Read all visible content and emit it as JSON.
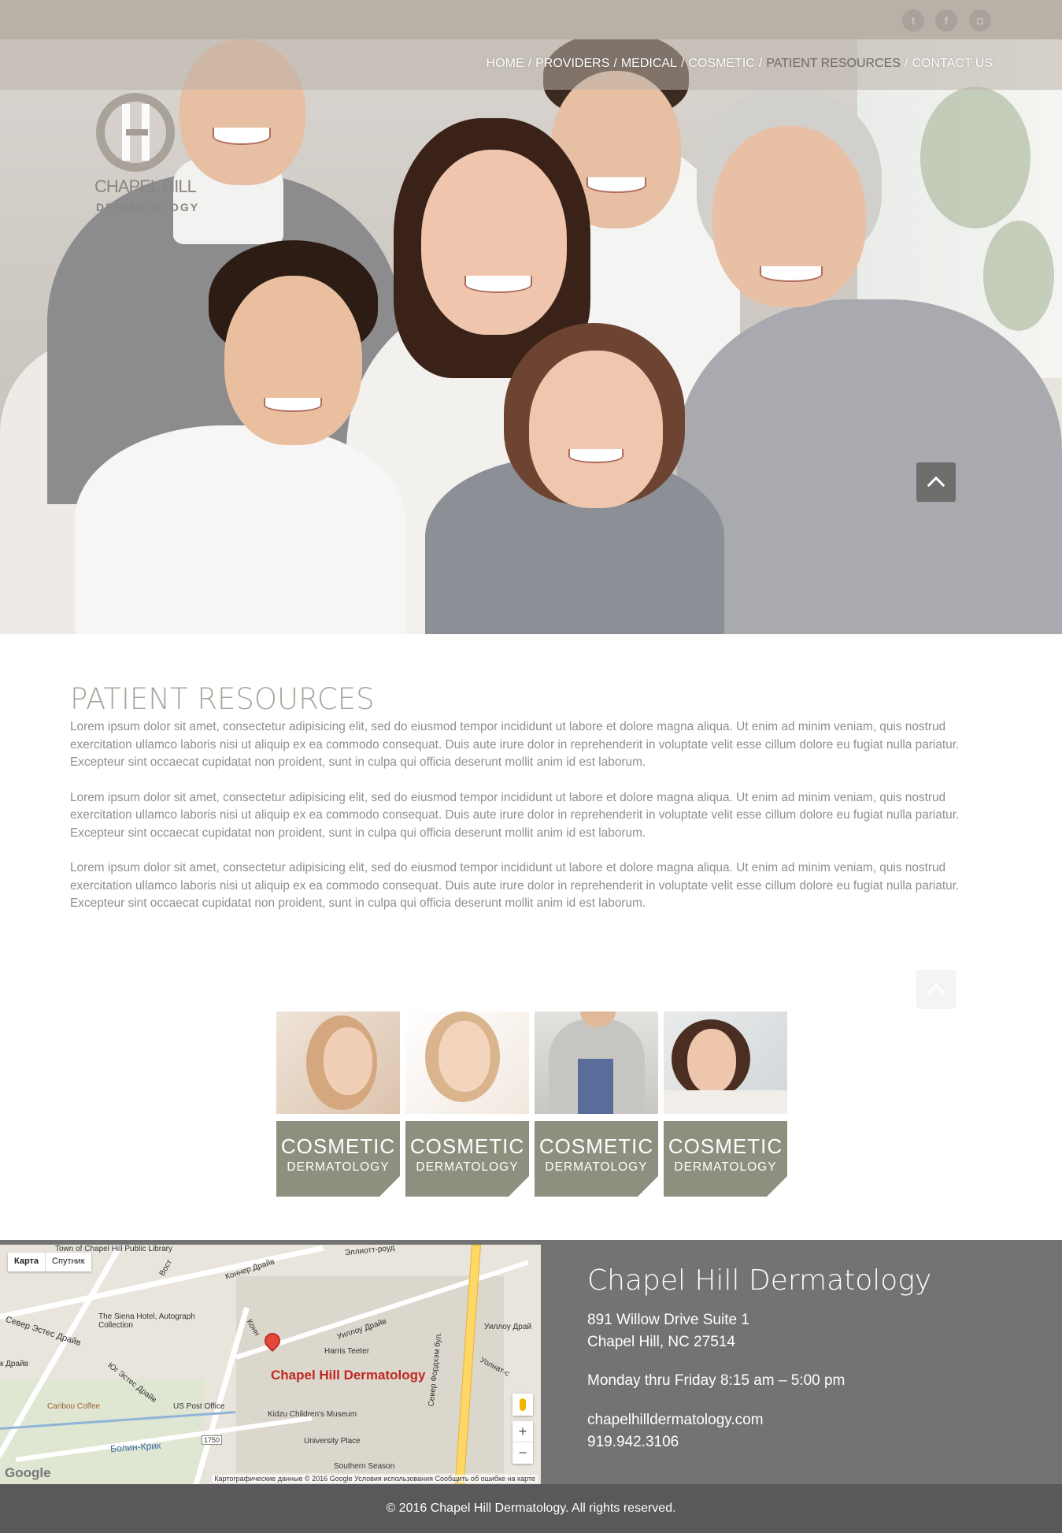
{
  "nav": {
    "items": [
      {
        "label": "HOME"
      },
      {
        "label": "PROVIDERS"
      },
      {
        "label": "MEDICAL"
      },
      {
        "label": "COSMETIC"
      },
      {
        "label": "PATIENT RESOURCES"
      },
      {
        "label": "CONTACT US"
      }
    ],
    "separator": "/"
  },
  "social": {
    "twitter": "t",
    "facebook": "f",
    "instagram": "◘"
  },
  "logo": {
    "line1": "CHAPEL HILL",
    "line2": "DERMATOLOGY"
  },
  "main": {
    "title": "PATIENT RESOURCES",
    "paragraphs": [
      "Lorem ipsum dolor sit amet, consectetur adipisicing elit, sed do eiusmod tempor incididunt ut labore et dolore magna aliqua. Ut enim ad minim veniam, quis nostrud exercitation ullamco laboris nisi ut aliquip ex ea commodo consequat. Duis aute irure dolor in reprehenderit in voluptate velit esse cillum dolore eu fugiat nulla pariatur. Excepteur sint occaecat cupidatat non proident, sunt in culpa qui officia deserunt mollit anim id est laborum.",
      "Lorem ipsum dolor sit amet, consectetur adipisicing elit, sed do eiusmod tempor incididunt ut labore et dolore magna aliqua. Ut enim ad minim veniam, quis nostrud exercitation ullamco laboris nisi ut aliquip ex ea commodo consequat. Duis aute irure dolor in reprehenderit in voluptate velit esse cillum dolore eu fugiat nulla pariatur. Excepteur sint occaecat cupidatat non proident, sunt in culpa qui officia deserunt mollit anim id est laborum.",
      "Lorem ipsum dolor sit amet, consectetur adipisicing elit, sed do eiusmod tempor incididunt ut labore et dolore magna aliqua. Ut enim ad minim veniam, quis nostrud exercitation ullamco laboris nisi ut aliquip ex ea commodo consequat. Duis aute irure dolor in reprehenderit in voluptate velit esse cillum dolore eu fugiat nulla pariatur. Excepteur sint occaecat cupidatat non proident, sunt in culpa qui officia deserunt mollit anim id est laborum."
    ]
  },
  "tiles": [
    {
      "title": "COSMETIC",
      "subtitle": "DERMATOLOGY"
    },
    {
      "title": "COSMETIC",
      "subtitle": "DERMATOLOGY"
    },
    {
      "title": "COSMETIC",
      "subtitle": "DERMATOLOGY"
    },
    {
      "title": "COSMETIC",
      "subtitle": "DERMATOLOGY"
    }
  ],
  "map": {
    "type_map": "Карта",
    "type_satellite": "Спутник",
    "marker_label": "Chapel Hill Dermatology",
    "zoom_in": "+",
    "zoom_out": "−",
    "attribution": "Картографические данные © 2016 Google   Условия использования   Сообщить об ошибке на карте",
    "google": "Google",
    "labels": {
      "library": "Town of Chapel Hill Public Library",
      "elliott": "Эллиотт-роуд",
      "konner": "Коннер Драйв",
      "siena": "The Siena Hotel, Autograph Collection",
      "willow": "Уиллоу Драйв",
      "willow2": "Уиллоу Драй",
      "harris": "Harris Teeter",
      "estes": "Север Эстес Драйв",
      "drive": "к Драйв",
      "caribou": "Caribou Coffee",
      "south_estes": "Юг Эстес Драйв",
      "post": "US Post Office",
      "kidzu": "Kidzu Children's Museum",
      "fordham": "Север Фордхэм бул.",
      "university": "University Place",
      "bolin": "Болин-Крик",
      "route": "1750",
      "southern": "Southern Season",
      "yolnat": "Уолнат-с",
      "konner_short": "Конн",
      "vost": "Вост"
    }
  },
  "contact": {
    "name": "Chapel Hill Dermatology",
    "address1": "891 Willow Drive Suite 1",
    "address2": "Chapel Hill, NC 27514",
    "hours": "Monday thru Friday 8:15 am – 5:00 pm",
    "website": "chapelhilldermatology.com",
    "phone": "919.942.3106"
  },
  "footer": {
    "copyright": "© 2016 Chapel Hill Dermatology. All rights reserved."
  }
}
